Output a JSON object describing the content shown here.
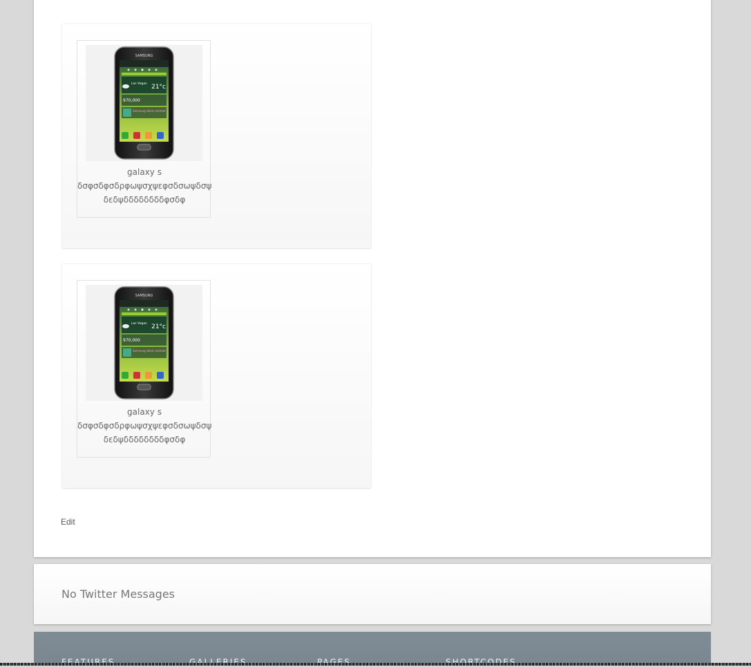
{
  "gallery": {
    "items": [
      {
        "image_alt": "Samsung Galaxy S phone",
        "title": "galaxy s",
        "line2": "δσφσδφσδρφωψσχψεφσδσωψδσψ",
        "line3": "δεδψδδδδδδδδφσδφ"
      },
      {
        "image_alt": "Samsung Galaxy S phone",
        "title": "galaxy s",
        "line2": "δσφσδφσδρφωψσχψεφσδσωψδσψ",
        "line3": "δεδψδδδδδδδδφσδφ"
      }
    ]
  },
  "edit_label": "Edit",
  "twitter": {
    "message": "No Twitter Messages"
  },
  "footer": {
    "headings": [
      "FEATURES",
      "GALLERIES",
      "PAGES",
      "SHORTCODES"
    ]
  },
  "phone_screen": {
    "brand": "SAMSUNG",
    "weather_city": "Las Vegas",
    "temperature": "21°c",
    "count": "970,000",
    "news": "Samsung latest android"
  }
}
